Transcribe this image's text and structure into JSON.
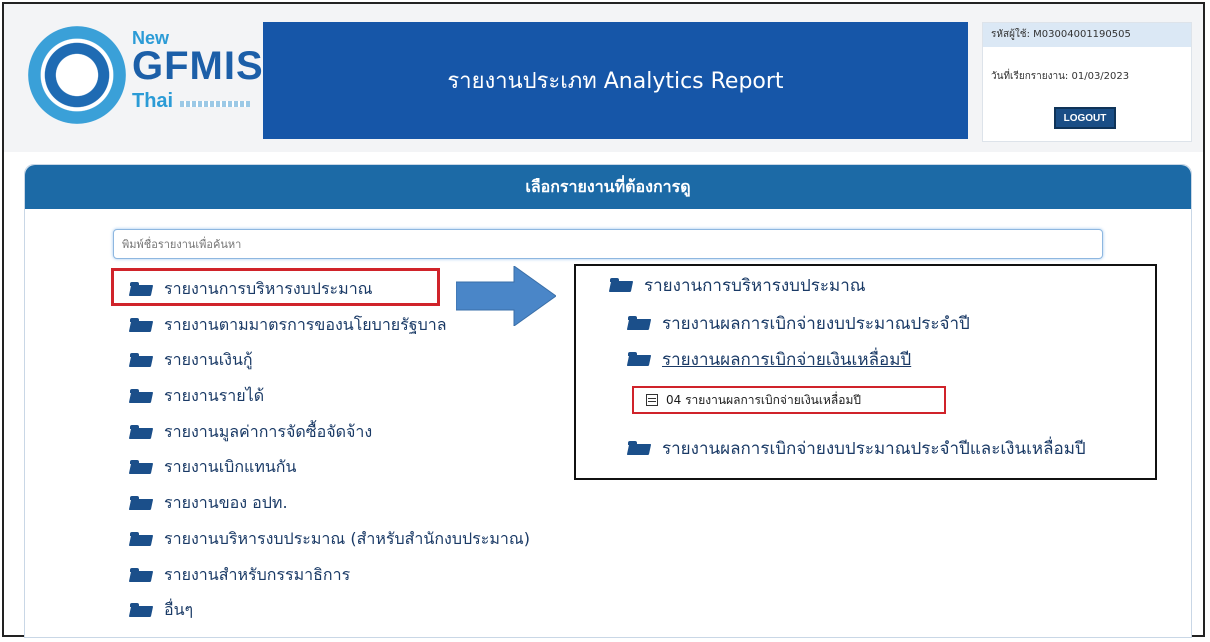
{
  "header": {
    "logo": {
      "line1": "New",
      "line2": "GFMIS",
      "line3": "Thai"
    },
    "title": "รายงานประเภท Analytics Report",
    "user_id_label": "รหัสผู้ใช้:",
    "user_id": "M03004001190505",
    "report_date_label": "วันที่เรียกรายงาน:",
    "report_date": "01/03/2023",
    "logout_label": "LOGOUT"
  },
  "panel": {
    "title": "เลือกรายงานที่ต้องการดู",
    "search_placeholder": "พิมพ์ชื่อรายงานเพื่อค้นหา"
  },
  "folders": [
    "รายงานการบริหารงบประมาณ",
    "รายงานตามมาตรการของนโยบายรัฐบาล",
    "รายงานเงินกู้",
    "รายงานรายได้",
    "รายงานมูลค่าการจัดซื้อจัดจ้าง",
    "รายงานเบิกแทนกัน",
    "รายงานของ อปท.",
    "รายงานบริหารงบประมาณ (สำหรับสำนักงบประมาณ)",
    "รายงานสำหรับกรรมาธิการ",
    "อื่นๆ"
  ],
  "detail": {
    "root": "รายงานการบริหารงบประมาณ",
    "sub1": "รายงานผลการเบิกจ่ายงบประมาณประจำปี",
    "sub2": "รายงานผลการเบิกจ่ายเงินเหลื่อมปี",
    "report": "04 รายงานผลการเบิกจ่ายเงินเหลื่อมปี",
    "sub3": "รายงานผลการเบิกจ่ายงบประมาณประจำปีและเงินเหลื่อมปี"
  },
  "colors": {
    "banner": "#1656a8",
    "panel_header": "#1c6aa6",
    "highlight": "#d0232a",
    "arrow": "#4a86c8"
  }
}
